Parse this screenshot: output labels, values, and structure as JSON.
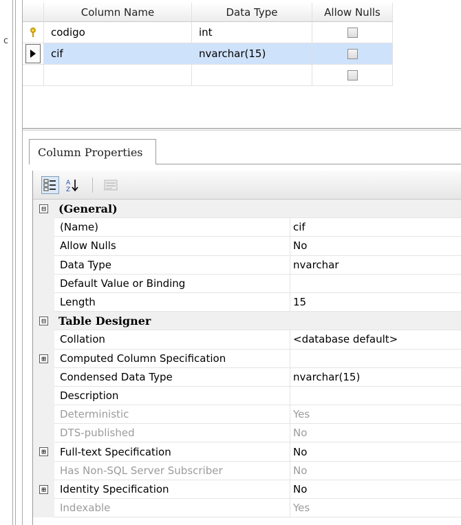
{
  "grid": {
    "headers": {
      "name": "Column Name",
      "type": "Data Type",
      "nulls": "Allow Nulls"
    },
    "rows": [
      {
        "name": "codigo",
        "type": "int",
        "key": true,
        "selected": false,
        "allow_nulls": false
      },
      {
        "name": "cif",
        "type": "nvarchar(15)",
        "key": false,
        "selected": true,
        "allow_nulls": false
      },
      {
        "name": "",
        "type": "",
        "key": false,
        "selected": false,
        "allow_nulls": false
      }
    ]
  },
  "left_strip": {
    "glyph": "c"
  },
  "tab": {
    "label": "Column Properties"
  },
  "toolbar": {
    "categorized_icon": "categorized-icon",
    "alphabetical_icon": "sort-az-icon",
    "property_pages_icon": "property-pages-icon"
  },
  "properties": [
    {
      "kind": "category",
      "label": "(General)",
      "expander": "⊟"
    },
    {
      "kind": "prop",
      "name": "(Name)",
      "value": "cif"
    },
    {
      "kind": "prop",
      "name": "Allow Nulls",
      "value": "No"
    },
    {
      "kind": "prop",
      "name": "Data Type",
      "value": "nvarchar"
    },
    {
      "kind": "prop",
      "name": "Default Value or Binding",
      "value": ""
    },
    {
      "kind": "prop",
      "name": "Length",
      "value": "15"
    },
    {
      "kind": "category",
      "label": "Table Designer",
      "expander": "⊟"
    },
    {
      "kind": "prop",
      "name": "Collation",
      "value": "<database default>"
    },
    {
      "kind": "prop",
      "name": "Computed Column Specification",
      "value": "",
      "expander": "⊞"
    },
    {
      "kind": "prop",
      "name": "Condensed Data Type",
      "value": "nvarchar(15)"
    },
    {
      "kind": "prop",
      "name": "Description",
      "value": ""
    },
    {
      "kind": "prop",
      "name": "Deterministic",
      "value": "Yes",
      "disabled": true
    },
    {
      "kind": "prop",
      "name": "DTS-published",
      "value": "No",
      "disabled": true
    },
    {
      "kind": "prop",
      "name": "Full-text Specification",
      "value": "No",
      "expander": "⊞"
    },
    {
      "kind": "prop",
      "name": "Has Non-SQL Server Subscriber",
      "value": "No",
      "disabled": true
    },
    {
      "kind": "prop",
      "name": "Identity Specification",
      "value": "No",
      "expander": "⊞"
    },
    {
      "kind": "prop",
      "name": "Indexable",
      "value": "Yes",
      "disabled": true
    }
  ],
  "colors": {
    "selection": "#cfe2fb",
    "disabled_text": "#9b9b9b",
    "gutter": "#f0f0f0"
  }
}
